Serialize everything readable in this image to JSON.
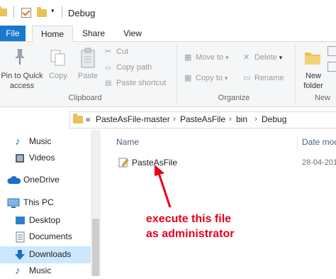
{
  "window": {
    "title": "Debug"
  },
  "quick_access_toolbar": {
    "icons": [
      "folder-icon",
      "properties-check-icon",
      "new-folder-icon",
      "customize-dropdown-icon"
    ]
  },
  "ribbon_tabs": {
    "file": "File",
    "home": "Home",
    "share": "Share",
    "view": "View"
  },
  "ribbon": {
    "clipboard": {
      "pin_label_line1": "Pin to Quick",
      "pin_label_line2": "access",
      "copy": "Copy",
      "paste": "Paste",
      "cut": "Cut",
      "copy_path": "Copy path",
      "paste_shortcut": "Paste shortcut",
      "group": "Clipboard"
    },
    "organize": {
      "move_to": "Move to",
      "copy_to": "Copy to",
      "delete": "Delete",
      "rename": "Rename",
      "group": "Organize"
    },
    "new": {
      "new_folder_line1": "New",
      "new_folder_line2": "folder",
      "group": "New"
    }
  },
  "address_bar": {
    "overflow": "«",
    "path": [
      "PasteAsFile-master",
      "PasteAsFile",
      "bin",
      "Debug"
    ]
  },
  "nav_pane": {
    "items": [
      {
        "label": "Music",
        "icon": "music-note-icon"
      },
      {
        "label": "Videos",
        "icon": "film-icon"
      },
      {
        "label": "OneDrive",
        "icon": "cloud-icon"
      },
      {
        "label": "This PC",
        "icon": "computer-icon"
      },
      {
        "label": "Desktop",
        "icon": "desktop-icon"
      },
      {
        "label": "Documents",
        "icon": "documents-icon"
      },
      {
        "label": "Downloads",
        "icon": "download-arrow-icon",
        "selected": true
      },
      {
        "label": "Music",
        "icon": "music-note-icon"
      }
    ]
  },
  "file_list": {
    "columns": {
      "name": "Name",
      "date": "Date mod"
    },
    "rows": [
      {
        "name": "PasteAsFile",
        "date": "28-04-201",
        "icon": "application-icon"
      }
    ]
  },
  "annotation": {
    "line1": "execute this file",
    "line2": "as administrator",
    "color": "#e8001c"
  },
  "colors": {
    "file_tab": "#1979ca",
    "selection": "#cce8ff",
    "folder": "#e9c25a"
  }
}
